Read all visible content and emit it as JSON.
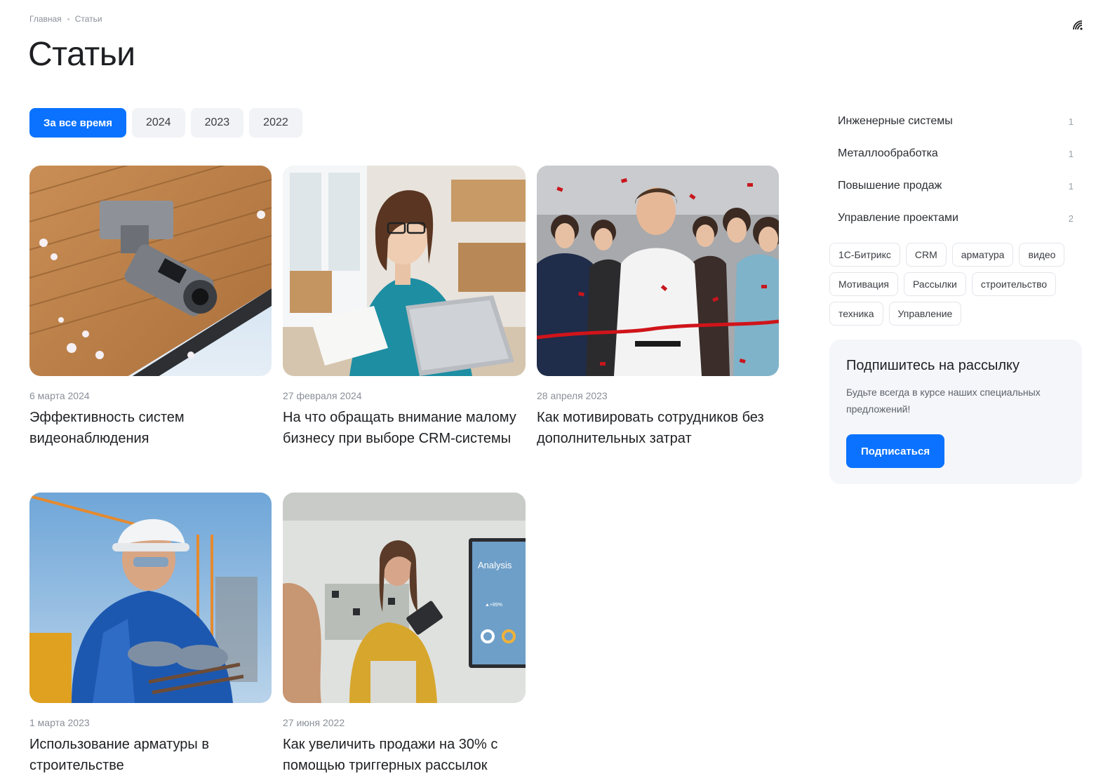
{
  "breadcrumb": {
    "home": "Главная",
    "current": "Статьи"
  },
  "page": {
    "title": "Статьи"
  },
  "filters": [
    "За все время",
    "2024",
    "2023",
    "2022"
  ],
  "articles": [
    {
      "date": "6 марта 2024",
      "title": "Эффективность систем видеонаблюдения",
      "image": "security-camera"
    },
    {
      "date": "27 февраля 2024",
      "title": "На что обращать внимание малому бизнесу при выборе CRM-системы",
      "image": "woman-laptop"
    },
    {
      "date": "28 апреля 2023",
      "title": "Как мотивировать сотрудников без дополнительных затрат",
      "image": "ribbon-cutting"
    },
    {
      "date": "1 марта 2023",
      "title": "Использование арматуры в строительстве",
      "image": "construction-worker"
    },
    {
      "date": "27 июня 2022",
      "title": "Как увеличить продажи на 30% с помощью триггерных рассылок",
      "image": "woman-presentation"
    }
  ],
  "categories": [
    {
      "label": "Инженерные системы",
      "count": "1"
    },
    {
      "label": "Металлообработка",
      "count": "1"
    },
    {
      "label": "Повышение продаж",
      "count": "1"
    },
    {
      "label": "Управление проектами",
      "count": "2"
    }
  ],
  "tags": [
    "1С-Битрикс",
    "CRM",
    "арматура",
    "видео",
    "Мотивация",
    "Рассылки",
    "строительство",
    "техника",
    "Управление"
  ],
  "subscribe": {
    "title": "Подпишитесь на рассылку",
    "text": "Будьте всегда в курсе наших специальных предложений!",
    "button": "Подписаться"
  },
  "colors": {
    "accent": "#0a72ff",
    "chip_bg": "#f1f3f6",
    "panel_bg": "#f4f6f9"
  },
  "presentation_screen": {
    "heading": "Analysis",
    "stat": "▲+89%"
  }
}
